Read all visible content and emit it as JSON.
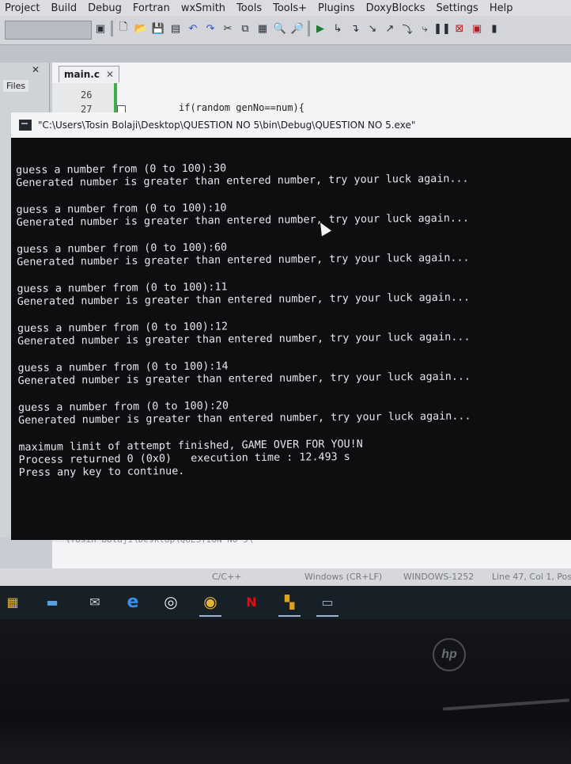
{
  "menu": [
    "Project",
    "Build",
    "Debug",
    "Fortran",
    "wxSmith",
    "Tools",
    "Tools+",
    "Plugins",
    "DoxyBlocks",
    "Settings",
    "Help"
  ],
  "editor": {
    "tab": "main.c",
    "line_numbers": [
      "26",
      "27"
    ],
    "code_line": "if(random_genNo==num){",
    "ghost_path": "\\Tosin Bolaji\\Desktop\\QUESTION NO 5\\"
  },
  "management": {
    "files_tab": "Files"
  },
  "console": {
    "title": "\"C:\\Users\\Tosin Bolaji\\Desktop\\QUESTION NO 5\\bin\\Debug\\QUESTION NO 5.exe\"",
    "attempts": [
      {
        "prompt": "guess a number from (0 to 100):30",
        "feedback": "Generated number is greater than entered number, try your luck again..."
      },
      {
        "prompt": "guess a number from (0 to 100):10",
        "feedback": "Generated number is greater than entered number, try your luck again..."
      },
      {
        "prompt": "guess a number from (0 to 100):60",
        "feedback": "Generated number is greater than entered number, try your luck again..."
      },
      {
        "prompt": "guess a number from (0 to 100):11",
        "feedback": "Generated number is greater than entered number, try your luck again..."
      },
      {
        "prompt": "guess a number from (0 to 100):12",
        "feedback": "Generated number is greater than entered number, try your luck again..."
      },
      {
        "prompt": "guess a number from (0 to 100):14",
        "feedback": "Generated number is greater than entered number, try your luck again..."
      },
      {
        "prompt": "guess a number from (0 to 100):20",
        "feedback": "Generated number is greater than entered number, try your luck again..."
      }
    ],
    "final_lines": [
      "maximum limit of attempt finished, GAME OVER FOR YOU!N",
      "Process returned 0 (0x0)   execution time : 12.493 s",
      "Press any key to continue."
    ]
  },
  "statusbar": {
    "language": "C/C++",
    "line_endings": "Windows (CR+LF)",
    "encoding": "WINDOWS-1252",
    "position": "Line 47, Col 1, Pos"
  },
  "taskbar": {
    "icons": [
      "store-icon",
      "file-explorer-icon",
      "mail-icon",
      "edge-icon",
      "groove-icon",
      "chrome-icon",
      "netflix-icon",
      "codeblocks-icon",
      "console-icon"
    ]
  },
  "brand": {
    "laptop_logo": "hp"
  }
}
